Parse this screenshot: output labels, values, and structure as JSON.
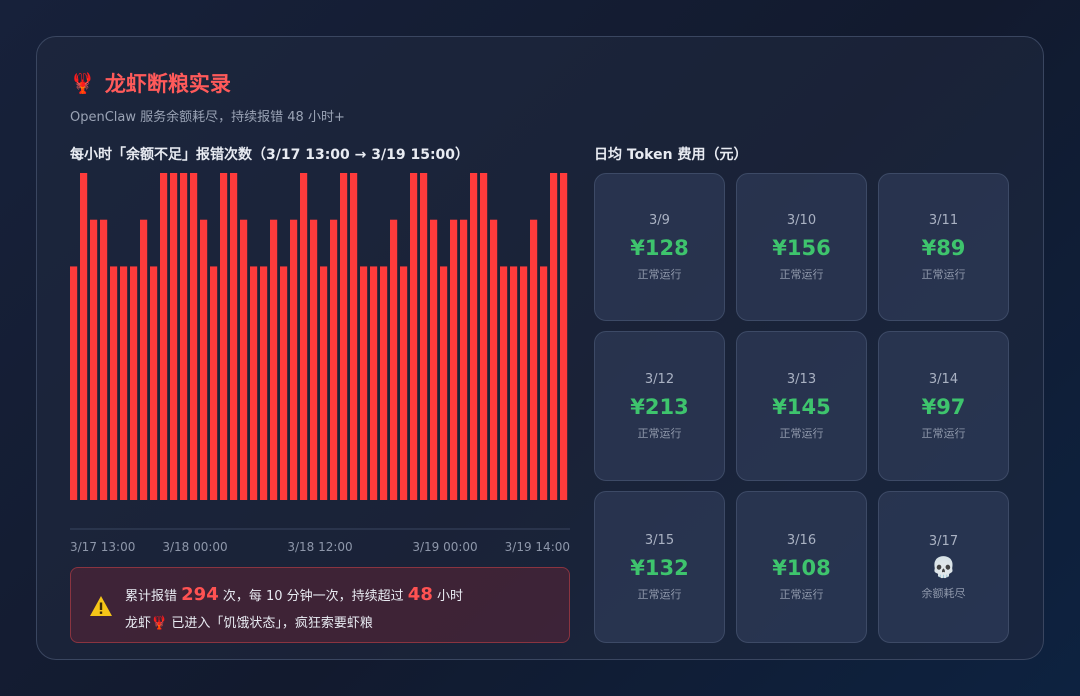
{
  "header": {
    "title_icon": "🦞",
    "title": "龙虾断粮实录",
    "subtitle": "OpenClaw 服务余额耗尽，持续报错 48 小时+"
  },
  "chart_data": {
    "type": "bar",
    "title": "每小时「余额不足」报错次数（3/17 13:00 → 3/19 15:00）",
    "xlabel": "",
    "ylabel": "",
    "ylim": [
      0,
      7
    ],
    "grid": false,
    "x_tick_labels": [
      "3/17 13:00",
      "3/18 00:00",
      "3/18 12:00",
      "3/19 00:00",
      "3/19 14:00"
    ],
    "bar_color": "#ff3b3b",
    "values": [
      5,
      7,
      6,
      6,
      5,
      5,
      5,
      6,
      5,
      7,
      7,
      7,
      7,
      6,
      5,
      7,
      7,
      6,
      5,
      5,
      6,
      5,
      6,
      7,
      6,
      5,
      6,
      7,
      7,
      5,
      5,
      5,
      6,
      5,
      7,
      7,
      6,
      5,
      6,
      6,
      7,
      7,
      6,
      5,
      5,
      5,
      6,
      5,
      7,
      7
    ]
  },
  "alert": {
    "icon": "warning-icon",
    "l1_a": "累计报错 ",
    "total_errors": "294",
    "l1_b": " 次，每 10 分钟一次，持续超过 ",
    "hours": "48",
    "l1_c": " 小时",
    "l2_a": "龙虾",
    "l2_icon": "🦞",
    "l2_b": " 已进入「饥饿状态」，疯狂索要虾粮"
  },
  "costs": {
    "title": "日均 Token 费用（元）",
    "normal_color": "#3ec46d",
    "tiles": [
      {
        "date": "3/9",
        "amount": "¥128",
        "status": "正常运行"
      },
      {
        "date": "3/10",
        "amount": "¥156",
        "status": "正常运行"
      },
      {
        "date": "3/11",
        "amount": "¥89",
        "status": "正常运行"
      },
      {
        "date": "3/12",
        "amount": "¥213",
        "status": "正常运行"
      },
      {
        "date": "3/13",
        "amount": "¥145",
        "status": "正常运行"
      },
      {
        "date": "3/14",
        "amount": "¥97",
        "status": "正常运行"
      },
      {
        "date": "3/15",
        "amount": "¥132",
        "status": "正常运行"
      },
      {
        "date": "3/16",
        "amount": "¥108",
        "status": "正常运行"
      },
      {
        "date": "3/17",
        "icon": "💀",
        "status": "余额耗尽"
      }
    ]
  }
}
